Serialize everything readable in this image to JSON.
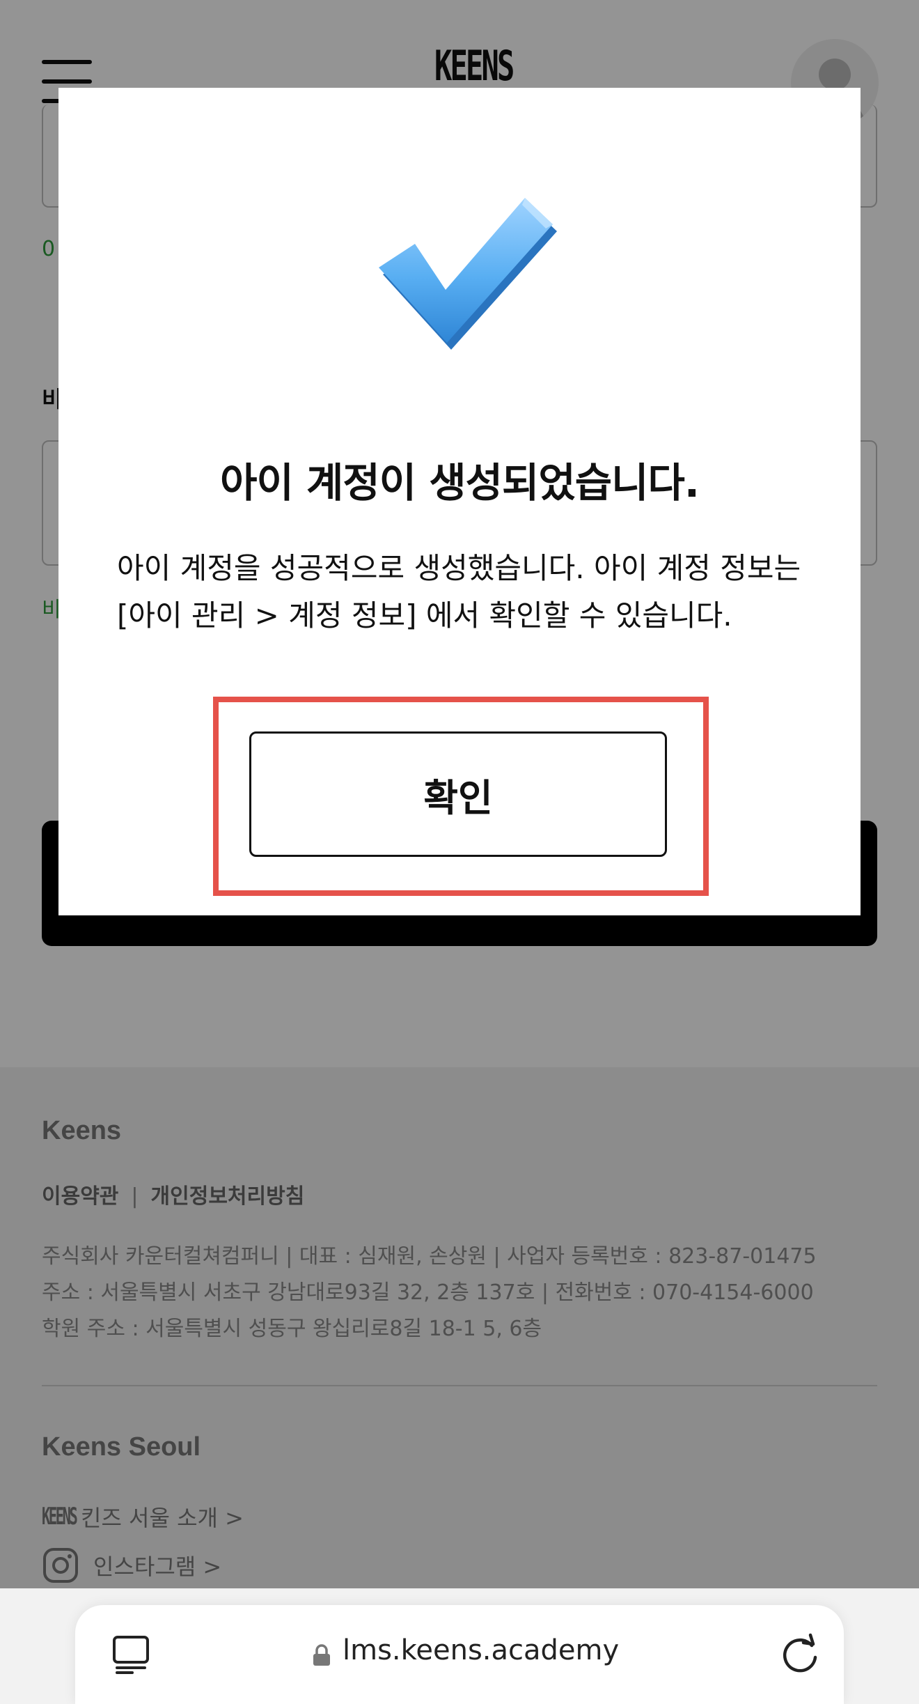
{
  "header": {
    "logo_text": "KEENS",
    "menu_icon": "hamburger-menu-icon",
    "avatar_icon": "user-avatar-icon"
  },
  "form": {
    "valid_msg_1": "0",
    "label_2": "비",
    "valid_msg_2": "비"
  },
  "modal": {
    "icon": "check-mark-icon",
    "title": "아이 계정이 생성되었습니다.",
    "body": "아이 계정을 성공적으로 생성했습니다. 아이 계정 정보는 [아이 관리 > 계정 정보] 에서 확인할 수 있습니다.",
    "confirm_label": "확인",
    "highlight_color": "#e5524a"
  },
  "footer": {
    "brand": "Keens",
    "terms_link": "이용약관",
    "separator": "|",
    "privacy_link": "개인정보처리방침",
    "info_line_1": "주식회사 카운터컬쳐컴퍼니 | 대표 : 심재원, 손상원 | 사업자 등록번호 : 823-87-01475",
    "info_line_2": "주소 : 서울특별시 서초구 강남대로93길 32, 2층 137호 | 전화번호 : 070-4154-6000",
    "info_line_3": "학원 주소 : 서울특별시 성동구 왕십리로8길 18-1 5, 6층",
    "seoul_title": "Keens Seoul",
    "mini_logo": "KEENS",
    "intro_link": "킨즈 서울 소개 >",
    "instagram_link": "인스타그램 >"
  },
  "browser": {
    "url": "lms.keens.academy",
    "tabs_icon": "tabs-icon",
    "lock_icon": "lock-icon",
    "reload_icon": "reload-icon"
  }
}
